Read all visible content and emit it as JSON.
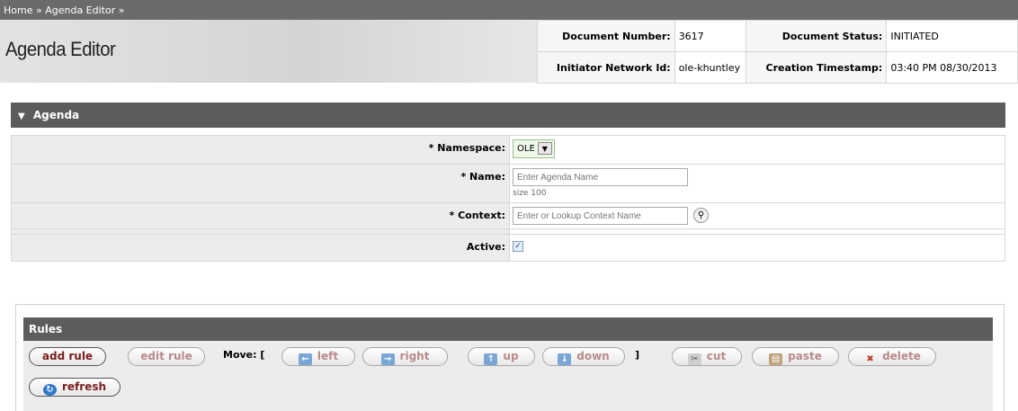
{
  "breadcrumb": {
    "home": "Home",
    "sep": "»",
    "editor": "Agenda Editor"
  },
  "header": {
    "title": "Agenda Editor"
  },
  "docinfo": {
    "doc_number_label": "Document Number:",
    "doc_number": "3617",
    "doc_status_label": "Document Status:",
    "doc_status": "INITIATED",
    "initiator_label": "Initiator Network Id:",
    "initiator": "ole-khuntley",
    "created_label": "Creation Timestamp:",
    "created": "03:40 PM 08/30/2013"
  },
  "agenda": {
    "section_title": "Agenda",
    "namespace_label": "* Namespace:",
    "namespace_value": "OLE",
    "name_label": "* Name:",
    "name_placeholder": "Enter Agenda Name",
    "name_size": "size 100",
    "context_label": "* Context:",
    "context_placeholder": "Enter or Lookup Context Name",
    "active_label": "Active:",
    "active_checked": true
  },
  "rules": {
    "title": "Rules",
    "add_rule": "add rule",
    "edit_rule": "edit rule",
    "move_label": "Move: [",
    "move_close": "]",
    "left": "left",
    "right": "right",
    "up": "up",
    "down": "down",
    "cut": "cut",
    "paste": "paste",
    "delete": "delete",
    "refresh": "refresh"
  },
  "colors": {
    "bar": "#5c5c5c",
    "breadcrumb": "#6b6b6b",
    "label_bg": "#ececec",
    "button_text_disabled": "#b98a8a",
    "button_text_active": "#7a1e1e"
  },
  "icons": [
    "triangle-down-icon",
    "dropdown-arrow-icon",
    "magnifier-icon",
    "checkbox-icon",
    "arrow-left-icon",
    "arrow-right-icon",
    "arrow-up-icon",
    "arrow-down-icon",
    "scissors-icon",
    "clipboard-icon",
    "delete-x-icon",
    "refresh-icon"
  ]
}
